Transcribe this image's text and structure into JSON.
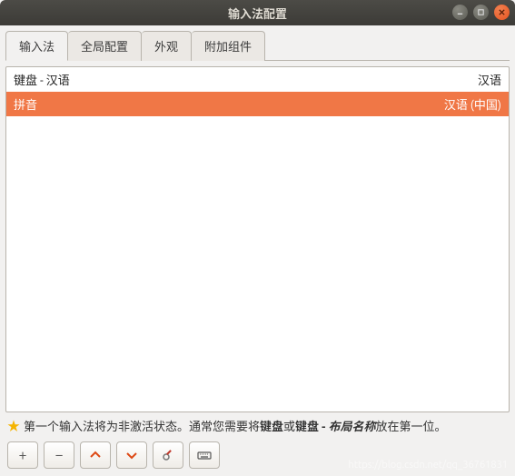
{
  "window": {
    "title": "输入法配置"
  },
  "tabs": [
    {
      "label": "输入法",
      "active": true
    },
    {
      "label": "全局配置",
      "active": false
    },
    {
      "label": "外观",
      "active": false
    },
    {
      "label": "附加组件",
      "active": false
    }
  ],
  "list": {
    "rows": [
      {
        "name": "键盘 - 汉语",
        "lang": "汉语",
        "selected": false
      },
      {
        "name": "拼音",
        "lang": "汉语 (中国)",
        "selected": true
      }
    ]
  },
  "hint": {
    "prefix": "第一个输入法将为非激活状态。通常您需要将",
    "bold1": "键盘",
    "mid": "或",
    "bold2": "键盘 - ",
    "italic": "布局名称",
    "suffix": "放在第一位。"
  },
  "toolbar": {
    "add": "+",
    "remove": "−"
  },
  "watermark": "https://blog.csdn.net/qq_36761831"
}
